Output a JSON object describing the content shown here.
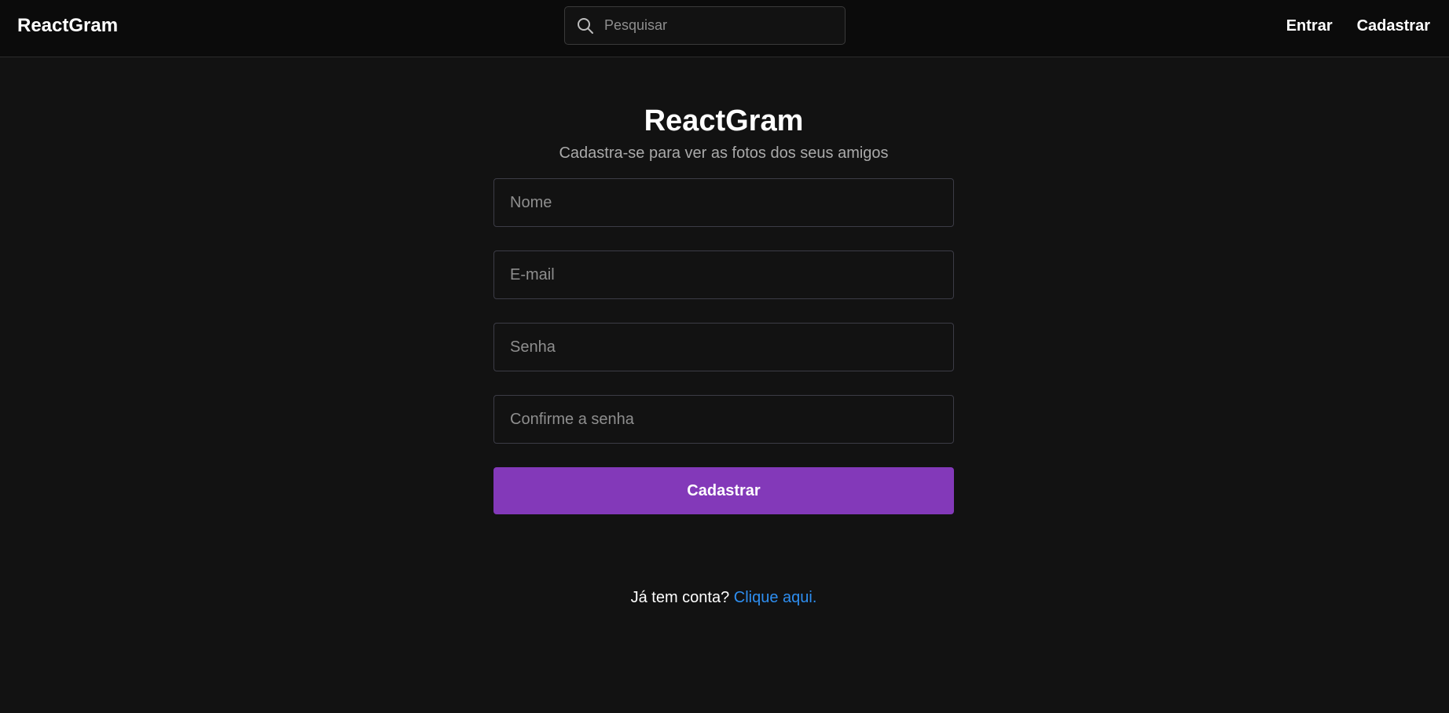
{
  "navbar": {
    "brand": "ReactGram",
    "search": {
      "placeholder": "Pesquisar",
      "icon": "search-icon"
    },
    "links": {
      "login": "Entrar",
      "register": "Cadastrar"
    }
  },
  "register": {
    "title": "ReactGram",
    "subtitle": "Cadastra-se para ver as fotos dos seus amigos",
    "fields": {
      "name_placeholder": "Nome",
      "email_placeholder": "E-mail",
      "password_placeholder": "Senha",
      "confirm_placeholder": "Confirme a senha"
    },
    "submit_label": "Cadastrar",
    "login_prompt": "Já tem conta?",
    "login_link": "Clique aqui."
  },
  "colors": {
    "background": "#121212",
    "navbar": "#0b0b0b",
    "accent": "#8339b9",
    "link": "#2e8ef0"
  }
}
